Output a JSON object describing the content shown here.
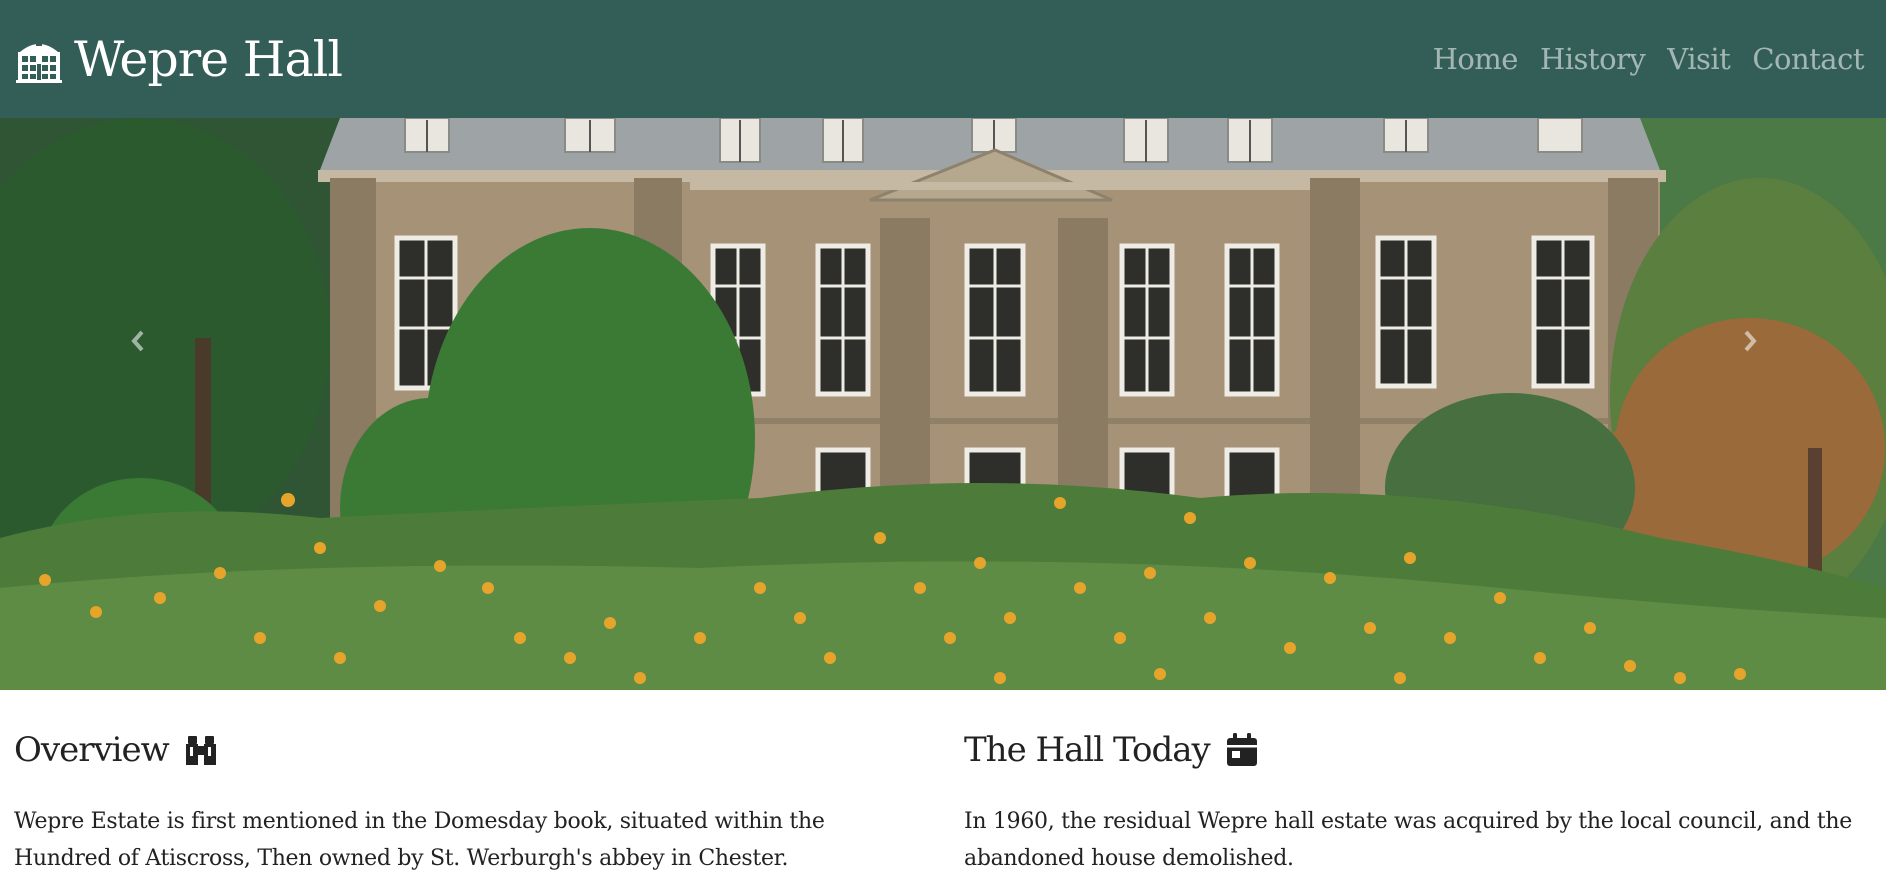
{
  "colors": {
    "navbar_bg": "#335e57",
    "text_dark": "#222222",
    "nav_link": "rgba(255,255,255,0.55)"
  },
  "brand": {
    "title": "Wepre Hall",
    "icon": "building-icon"
  },
  "nav": {
    "links": [
      {
        "label": "Home"
      },
      {
        "label": "History"
      },
      {
        "label": "Visit"
      },
      {
        "label": "Contact"
      }
    ]
  },
  "hero": {
    "image": "hall-with-sunflowers-photo",
    "prev_icon": "chevron-left-icon",
    "next_icon": "chevron-right-icon"
  },
  "overview": {
    "title": "Overview",
    "icon": "binoculars-icon",
    "text": "Wepre Estate is first mentioned in the Domesday book, situated within the Hundred of Atiscross, Then owned by St. Werburgh's abbey in Chester."
  },
  "today": {
    "title": "The Hall Today",
    "icon": "calendar-icon",
    "text": "In 1960, the residual Wepre hall estate was acquired by the local council, and the abandoned house demolished."
  }
}
